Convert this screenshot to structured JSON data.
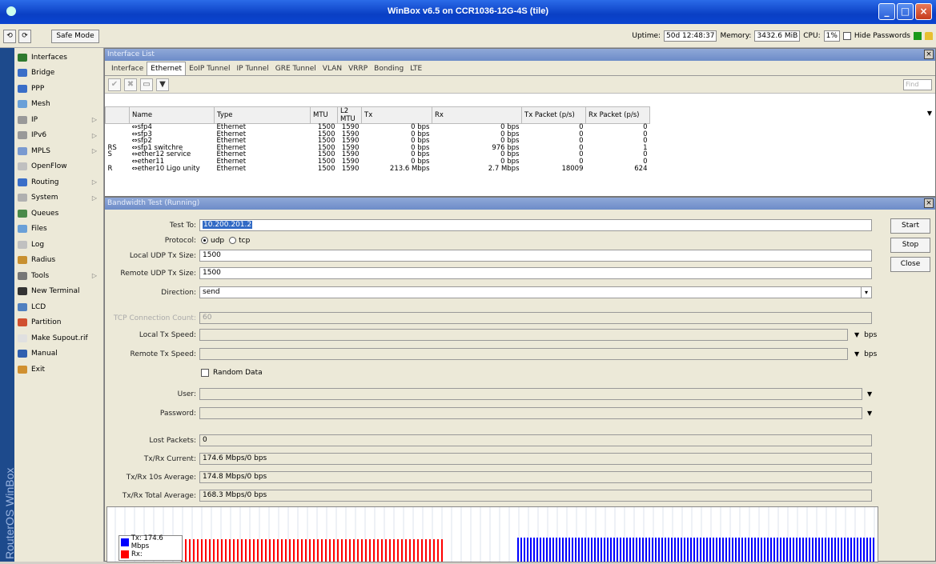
{
  "window": {
    "title": "WinBox v6.5 on CCR1036-12G-4S (tile)"
  },
  "toolbar": {
    "undo": "⟲",
    "redo": "⟳",
    "safe_mode": "Safe Mode",
    "uptime_label": "Uptime:",
    "uptime": "50d 12:48:37",
    "memory_label": "Memory:",
    "memory": "3432.6 MiB",
    "cpu_label": "CPU:",
    "cpu": "1%",
    "hide_passwords": "Hide Passwords"
  },
  "brand": "RouterOS WinBox",
  "sidebar": {
    "items": [
      {
        "label": "Interfaces",
        "color": "#2f7a2f",
        "sub": false
      },
      {
        "label": "Bridge",
        "color": "#3a6ec8",
        "sub": false
      },
      {
        "label": "PPP",
        "color": "#3a6ec8",
        "sub": false
      },
      {
        "label": "Mesh",
        "color": "#6aa0d8",
        "sub": false
      },
      {
        "label": "IP",
        "color": "#999999",
        "sub": true
      },
      {
        "label": "IPv6",
        "color": "#999999",
        "sub": true
      },
      {
        "label": "MPLS",
        "color": "#7a9ad0",
        "sub": true
      },
      {
        "label": "OpenFlow",
        "color": "#c0c0c0",
        "sub": false
      },
      {
        "label": "Routing",
        "color": "#3a6ec8",
        "sub": true
      },
      {
        "label": "System",
        "color": "#b0b0b0",
        "sub": true
      },
      {
        "label": "Queues",
        "color": "#4a8a4a",
        "sub": false
      },
      {
        "label": "Files",
        "color": "#6aa0d8",
        "sub": false
      },
      {
        "label": "Log",
        "color": "#c0c0c0",
        "sub": false
      },
      {
        "label": "Radius",
        "color": "#c89030",
        "sub": false
      },
      {
        "label": "Tools",
        "color": "#777777",
        "sub": true
      },
      {
        "label": "New Terminal",
        "color": "#333333",
        "sub": false
      },
      {
        "label": "LCD",
        "color": "#5080c0",
        "sub": false
      },
      {
        "label": "Partition",
        "color": "#d05030",
        "sub": false
      },
      {
        "label": "Make Supout.rif",
        "color": "#e0e0e0",
        "sub": false
      },
      {
        "label": "Manual",
        "color": "#3060b0",
        "sub": false
      },
      {
        "label": "Exit",
        "color": "#d09030",
        "sub": false
      }
    ]
  },
  "interface_list": {
    "title": "Interface List",
    "close": "×",
    "tabs": [
      "Interface",
      "Ethernet",
      "EoIP Tunnel",
      "IP Tunnel",
      "GRE Tunnel",
      "VLAN",
      "VRRP",
      "Bonding",
      "LTE"
    ],
    "active_tab": 1,
    "tools": [
      "✔",
      "✖",
      "▭",
      "▼"
    ],
    "find_placeholder": "Find",
    "columns": [
      "",
      "Name",
      "Type",
      "MTU",
      "L2 MTU",
      "Tx",
      "Rx",
      "Tx Packet (p/s)",
      "Rx Packet (p/s)"
    ],
    "rows": [
      [
        "",
        "⇔sfp4",
        "Ethernet",
        "1500",
        "1590",
        "0 bps",
        "0 bps",
        "0",
        "0"
      ],
      [
        "",
        "⇔sfp3",
        "Ethernet",
        "1500",
        "1590",
        "0 bps",
        "0 bps",
        "0",
        "0"
      ],
      [
        "",
        "⇔sfp2",
        "Ethernet",
        "1500",
        "1590",
        "0 bps",
        "0 bps",
        "0",
        "0"
      ],
      [
        "RS",
        "⇔sfp1 switchre",
        "Ethernet",
        "1500",
        "1590",
        "0 bps",
        "976 bps",
        "0",
        "1"
      ],
      [
        "S",
        "⇔ether12 service",
        "Ethernet",
        "1500",
        "1590",
        "0 bps",
        "0 bps",
        "0",
        "0"
      ],
      [
        "",
        "⇔ether11",
        "Ethernet",
        "1500",
        "1590",
        "0 bps",
        "0 bps",
        "0",
        "0"
      ],
      [
        "R",
        "⇔ether10 Ligo unity",
        "Ethernet",
        "1500",
        "1590",
        "213.6 Mbps",
        "2.7 Mbps",
        "18009",
        "624"
      ]
    ]
  },
  "bandwidth_test": {
    "title": "Bandwidth Test (Running)",
    "close": "×",
    "test_to_label": "Test To:",
    "test_to": "10.200.201.2",
    "protocol_label": "Protocol:",
    "protocol_udp": "udp",
    "protocol_tcp": "tcp",
    "local_udp_label": "Local UDP Tx Size:",
    "local_udp": "1500",
    "remote_udp_label": "Remote UDP Tx Size:",
    "remote_udp": "1500",
    "direction_label": "Direction:",
    "direction": "send",
    "tcp_count_label": "TCP Connection Count:",
    "tcp_count": "60",
    "local_speed_label": "Local Tx Speed:",
    "remote_speed_label": "Remote Tx Speed:",
    "unit": "bps",
    "random_data": "Random Data",
    "user_label": "User:",
    "password_label": "Password:",
    "lost_packets_label": "Lost Packets:",
    "lost_packets": "0",
    "current_label": "Tx/Rx Current:",
    "current": "174.6 Mbps/0 bps",
    "avg10_label": "Tx/Rx 10s Average:",
    "avg10": "174.8 Mbps/0 bps",
    "total_label": "Tx/Rx Total Average:",
    "total": "168.3 Mbps/0 bps",
    "buttons": {
      "start": "Start",
      "stop": "Stop",
      "close": "Close"
    },
    "legend": {
      "tx": "Tx: 174.6 Mbps",
      "rx": "Rx:",
      "tx_color": "#0000ff",
      "rx_color": "#ff0000"
    }
  }
}
